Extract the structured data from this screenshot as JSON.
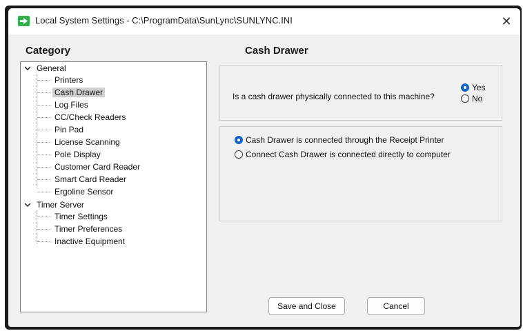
{
  "window": {
    "title": "Local System Settings - C:\\ProgramData\\SunLync\\SUNLYNC.INI",
    "close_glyph": "✕",
    "app_icon": "sunlync-app-icon"
  },
  "category": {
    "heading": "Category",
    "groups": [
      {
        "label": "General",
        "expanded": true,
        "items": [
          "Printers",
          "Cash Drawer",
          "Log Files",
          "CC/Check Readers",
          "Pin Pad",
          "License Scanning",
          "Pole Display",
          "Customer Card Reader",
          "Smart Card Reader",
          "Ergoline Sensor"
        ]
      },
      {
        "label": "Timer Server",
        "expanded": true,
        "items": [
          "Timer Settings",
          "Timer Preferences",
          "Inactive Equipment"
        ]
      }
    ],
    "selected": "Cash Drawer"
  },
  "cash_drawer": {
    "heading": "Cash Drawer",
    "question": "Is a cash drawer physically connected to this machine?",
    "yes_label": "Yes",
    "no_label": "No",
    "connected": "Yes",
    "options": [
      {
        "label": "Cash Drawer is connected through the Receipt Printer",
        "selected": true
      },
      {
        "label": "Connect Cash Drawer is connected directly to computer",
        "selected": false
      }
    ]
  },
  "buttons": {
    "save_close": "Save and Close",
    "cancel": "Cancel"
  },
  "colors": {
    "accent": "#1366c0",
    "selection": "#cfcfcf",
    "app_icon": "#2fb24a"
  }
}
